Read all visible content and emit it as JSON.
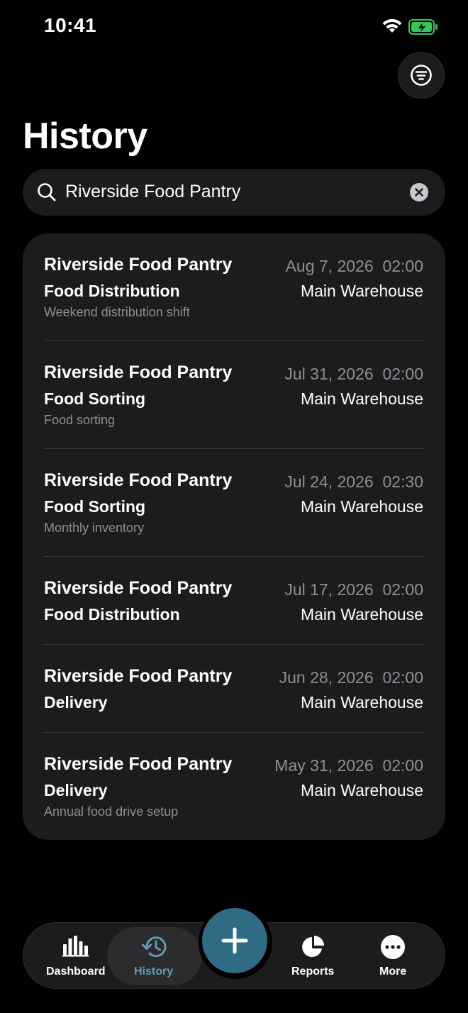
{
  "status_bar": {
    "time": "10:41"
  },
  "header": {
    "title": "History"
  },
  "search": {
    "value": "Riverside Food Pantry"
  },
  "entries": [
    {
      "org": "Riverside Food Pantry",
      "date": "Aug 7, 2026",
      "duration": "02:00",
      "activity": "Food Distribution",
      "location": "Main Warehouse",
      "note": "Weekend distribution shift"
    },
    {
      "org": "Riverside Food Pantry",
      "date": "Jul 31, 2026",
      "duration": "02:00",
      "activity": "Food Sorting",
      "location": "Main Warehouse",
      "note": "Food sorting"
    },
    {
      "org": "Riverside Food Pantry",
      "date": "Jul 24, 2026",
      "duration": "02:30",
      "activity": "Food Sorting",
      "location": "Main Warehouse",
      "note": "Monthly inventory"
    },
    {
      "org": "Riverside Food Pantry",
      "date": "Jul 17, 2026",
      "duration": "02:00",
      "activity": "Food Distribution",
      "location": "Main Warehouse",
      "note": ""
    },
    {
      "org": "Riverside Food Pantry",
      "date": "Jun 28, 2026",
      "duration": "02:00",
      "activity": "Delivery",
      "location": "Main Warehouse",
      "note": ""
    },
    {
      "org": "Riverside Food Pantry",
      "date": "May 31, 2026",
      "duration": "02:00",
      "activity": "Delivery",
      "location": "Main Warehouse",
      "note": "Annual food drive setup"
    }
  ],
  "tabbar": {
    "dashboard": "Dashboard",
    "history": "History",
    "reports": "Reports",
    "more": "More"
  },
  "colors": {
    "accent": "#2f6b82",
    "active_tab_text": "#5e9bb3",
    "battery": "#34c759",
    "card_bg": "#1c1c1e",
    "secondary_text": "#8e8e93"
  },
  "icons": {
    "filter": "filter-lines-icon",
    "search": "magnifier-icon",
    "clear": "x-circle-icon",
    "dashboard": "bar-chart-icon",
    "history": "clock-arrow-icon",
    "add": "plus-icon",
    "reports": "pie-chart-icon",
    "more": "ellipsis-circle-icon"
  }
}
